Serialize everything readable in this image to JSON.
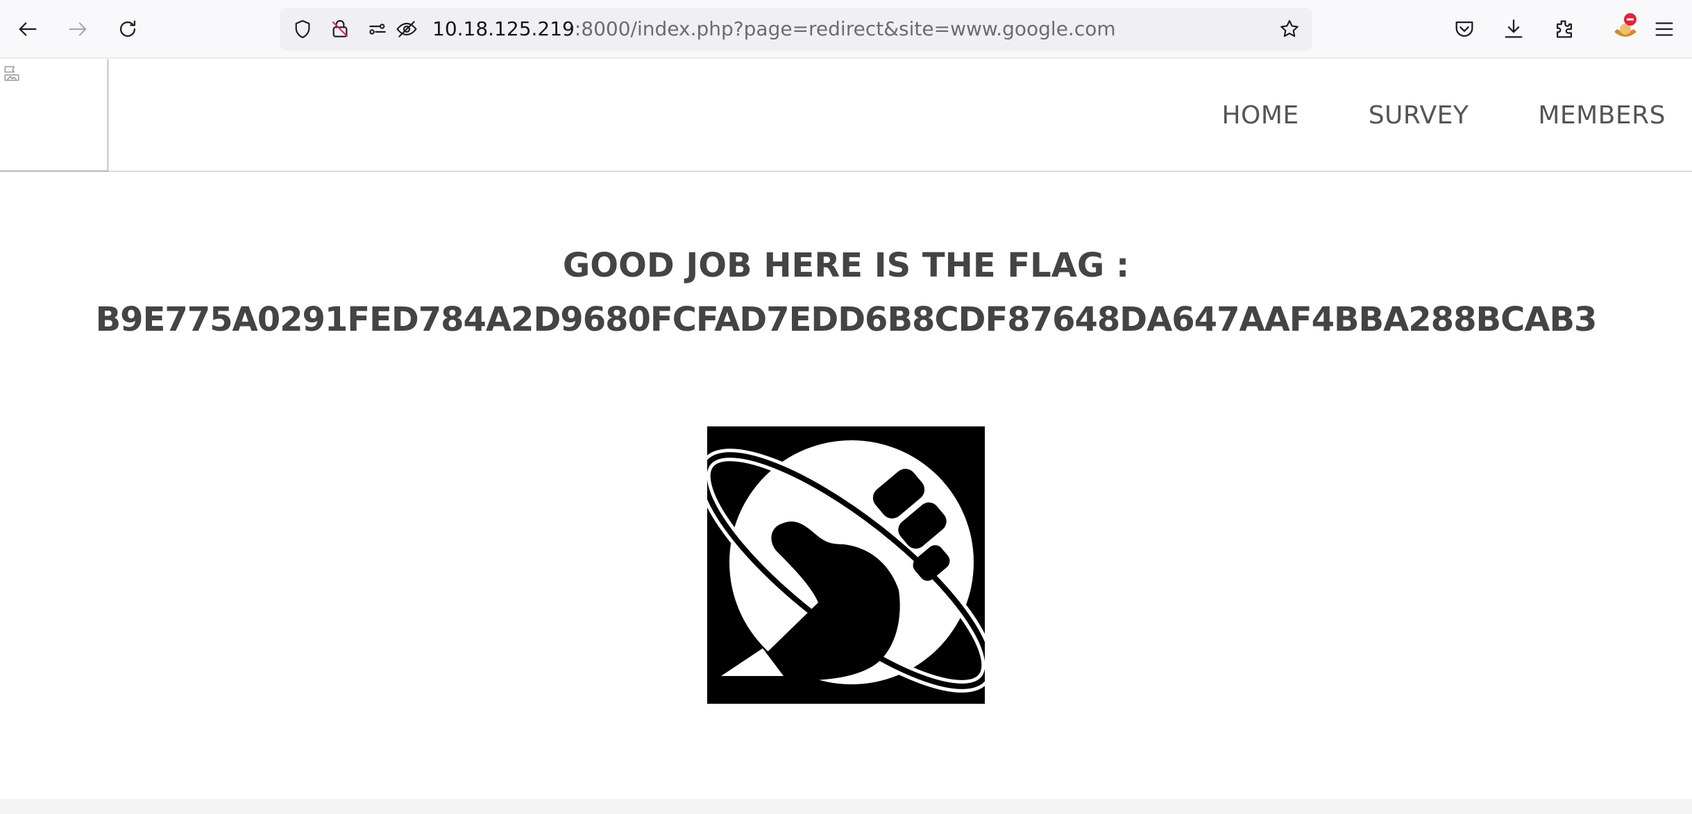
{
  "browser": {
    "url_host": "10.18.125.219",
    "url_rest": ":8000/index.php?page=redirect&site=www.google.com",
    "icons": [
      "back-icon",
      "forward-icon",
      "reload-icon",
      "shield-icon",
      "insecure-lock-icon",
      "permissions-icon",
      "tracking-icon",
      "bookmark-star-icon",
      "pocket-icon",
      "downloads-icon",
      "extensions-icon",
      "extension-badge-icon",
      "menu-icon"
    ]
  },
  "site": {
    "nav": {
      "home": "HOME",
      "survey": "SURVEY",
      "members": "MEMBERS"
    },
    "flag_title": "GOOD JOB HERE IS THE FLAG :",
    "flag_value": "B9E775A0291FED784A2D9680FCFAD7EDD6B8CDF87648DA647AAF4BBA288BCAB3",
    "emblem": "thumbs-up-planet-emblem"
  },
  "colors": {
    "toolbar_bg": "#f9f9fb",
    "urlbar_bg": "#f0f0f4",
    "heading_text": "#444444",
    "nav_text": "#555555"
  }
}
